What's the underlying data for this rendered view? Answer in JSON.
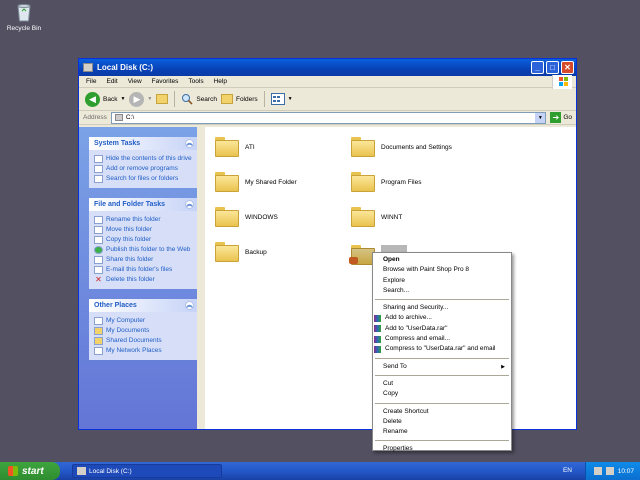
{
  "desktop": {
    "recycle_label": "Recycle Bin"
  },
  "window": {
    "title": "Local Disk (C:)",
    "controls": {
      "minimize": "_",
      "maximize": "□",
      "close": "✕"
    },
    "menu": [
      "File",
      "Edit",
      "View",
      "Favorites",
      "Tools",
      "Help"
    ],
    "toolbar": {
      "back": "Back",
      "search": "Search",
      "folders": "Folders"
    },
    "address": {
      "label": "Address",
      "value": "C:\\",
      "go": "Go"
    },
    "system_tasks": {
      "title": "System Tasks",
      "items": [
        "Hide the contents of this drive",
        "Add or remove programs",
        "Search for files or folders"
      ]
    },
    "file_folder_tasks": {
      "title": "File and Folder Tasks",
      "items": [
        "Rename this folder",
        "Move this folder",
        "Copy this folder",
        "Publish this folder to the Web",
        "Share this folder",
        "E-mail this folder's files",
        "Delete this folder"
      ]
    },
    "other_places": {
      "title": "Other Places",
      "items": [
        "My Computer",
        "My Documents",
        "Shared Documents",
        "My Network Places"
      ]
    },
    "folders": [
      "ATI",
      "Documents and Settings",
      "My Shared Folder",
      "Program Files",
      "WINDOWS",
      "WINNT",
      "Backup"
    ]
  },
  "context_menu": {
    "open": "Open",
    "browse_psp": "Browse with Paint Shop Pro 8",
    "explore": "Explore",
    "search": "Search...",
    "sharing": "Sharing and Security...",
    "add_archive": "Add to archive...",
    "add_userdata": "Add to \"UserData.rar\"",
    "compress_email": "Compress and email...",
    "compress_userdata_email": "Compress to \"UserData.rar\" and email",
    "send_to": "Send To",
    "cut": "Cut",
    "copy": "Copy",
    "create_shortcut": "Create Shortcut",
    "delete": "Delete",
    "rename": "Rename",
    "properties": "Properties"
  },
  "taskbar": {
    "start": "start",
    "task_button": "Local Disk (C:)",
    "language": "EN",
    "clock": "10:07"
  }
}
